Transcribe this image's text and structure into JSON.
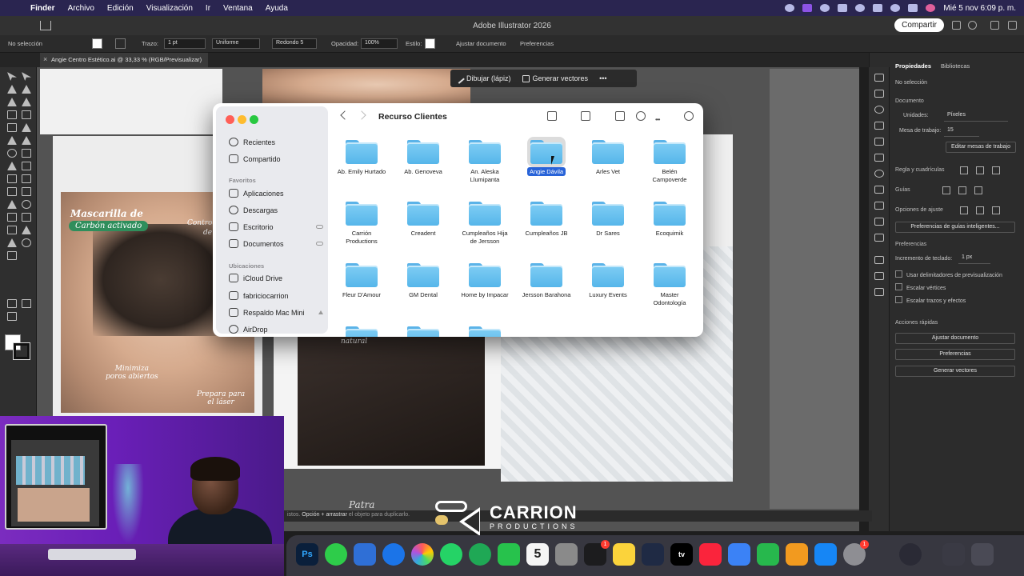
{
  "menubar": {
    "items": [
      "Finder",
      "Archivo",
      "Edición",
      "Visualización",
      "Ir",
      "Ventana",
      "Ayuda"
    ],
    "clock": "Mié 5 nov  6:09 p. m."
  },
  "appbar": {
    "title": "Adobe Illustrator 2026",
    "share_label": "Compartir"
  },
  "control_bar": {
    "selection": "No selección",
    "stroke_label": "Trazo:",
    "stroke_value": "1 pt",
    "uniform": "Uniforme",
    "brush": "Redondo 5",
    "opacity_label": "Opacidad:",
    "opacity_value": "100%",
    "style_label": "Estilo:",
    "fit_doc": "Ajustar documento",
    "prefs": "Preferencias"
  },
  "document_tab": "Angie Centro Estético.ai @ 33,33 % (RGB/Previsualizar)",
  "float_bar": {
    "draw": "Dibujar (lápiz)",
    "vectors": "Generar vectores"
  },
  "artwork": {
    "title_line1": "Mascarilla de",
    "title_line2": "Carbón activado",
    "caption_control": "Control",
    "caption_de": "de",
    "caption_pores": "Minimiza\nporos abiertos",
    "caption_laser": "Prepara para\nel láser",
    "caption_natural": "natural",
    "signature": "Patra"
  },
  "finder": {
    "title": "Recurso Clientes",
    "sidebar": {
      "top": [
        {
          "label": "Recientes",
          "icon": "clock-icon"
        },
        {
          "label": "Compartido",
          "icon": "shared-folder-icon"
        }
      ],
      "favorites_title": "Favoritos",
      "favorites": [
        {
          "label": "Aplicaciones",
          "icon": "apps-icon",
          "cloud": false
        },
        {
          "label": "Descargas",
          "icon": "download-icon",
          "cloud": false
        },
        {
          "label": "Escritorio",
          "icon": "desktop-icon",
          "cloud": true
        },
        {
          "label": "Documentos",
          "icon": "document-icon",
          "cloud": true
        }
      ],
      "locations_title": "Ubicaciones",
      "locations": [
        {
          "label": "iCloud Drive",
          "icon": "icloud-icon"
        },
        {
          "label": "fabriciocarrion",
          "icon": "home-icon"
        },
        {
          "label": "Respaldo Mac Mini",
          "icon": "drive-icon",
          "eject": true
        },
        {
          "label": "AirDrop",
          "icon": "airdrop-icon"
        }
      ]
    },
    "folders": [
      "Ab. Emily Hurtado",
      "Ab. Genoveva",
      "An. Aleska\nLlumipanta",
      "Angie Dávila",
      "Arles Vet",
      "Belén\nCampoverde",
      "Carrión\nProductions",
      "Creadent",
      "Cumpleaños Hija\nde Jersson",
      "Cumpleaños JB",
      "Dr Sares",
      "Ecoquimik",
      "Fleur D'Amour",
      "GM Dental",
      "Home by Impacar",
      "Jersson Barahona",
      "Luxury Events",
      "Master\nOdontología"
    ],
    "selected_folder": "Angie Dávila"
  },
  "properties_panel": {
    "tabs": [
      "Propiedades",
      "Bibliotecas"
    ],
    "no_selection": "No selección",
    "document": "Documento",
    "units_label": "Unidades:",
    "units_value": "Píxeles",
    "artboard_label": "Mesa de trabajo:",
    "artboard_value": "15",
    "edit_artboards": "Editar mesas de trabajo",
    "rulers": "Regla y cuadrículas",
    "guides": "Guías",
    "snap": "Opciones de ajuste",
    "smart_guides": "Preferencias de guías inteligentes...",
    "preferences": "Preferencias",
    "keyboard_inc_label": "Incremento de teclado:",
    "keyboard_inc_value": "1 px",
    "check_preview": "Usar delimitadores de previsualización",
    "check_corners": "Escalar vértices",
    "check_strokes": "Escalar trazos y efectos",
    "quick_actions": "Acciones rápidas",
    "qa_fit": "Ajustar documento",
    "qa_prefs": "Preferencias",
    "qa_vectors": "Generar vectores"
  },
  "status_bar": {
    "prefix": "istos.",
    "hint_bold": "Opción + arrastrar",
    "hint": " el objeto para duplicarlo."
  },
  "logo": {
    "name": "CARRION",
    "sub": "PRODUCTIONS"
  },
  "dock": {
    "calendar_day": "5",
    "badges": {
      "reminders": "1",
      "settings": "1"
    }
  }
}
